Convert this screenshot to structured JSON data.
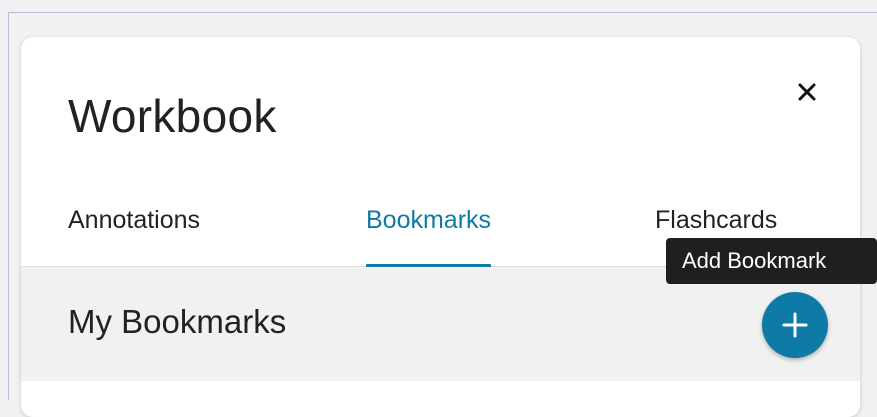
{
  "panel": {
    "title": "Workbook",
    "close_icon": "close-icon"
  },
  "tabs": [
    {
      "label": "Annotations",
      "active": false
    },
    {
      "label": "Bookmarks",
      "active": true
    },
    {
      "label": "Flashcards",
      "active": false
    }
  ],
  "section": {
    "title": "My Bookmarks",
    "add_icon": "plus-icon"
  },
  "tooltip": {
    "text": "Add Bookmark"
  },
  "colors": {
    "accent": "#0e7ba6",
    "text": "#222222",
    "section_bg": "#f1f1f1",
    "tooltip_bg": "#1f1f1f"
  }
}
